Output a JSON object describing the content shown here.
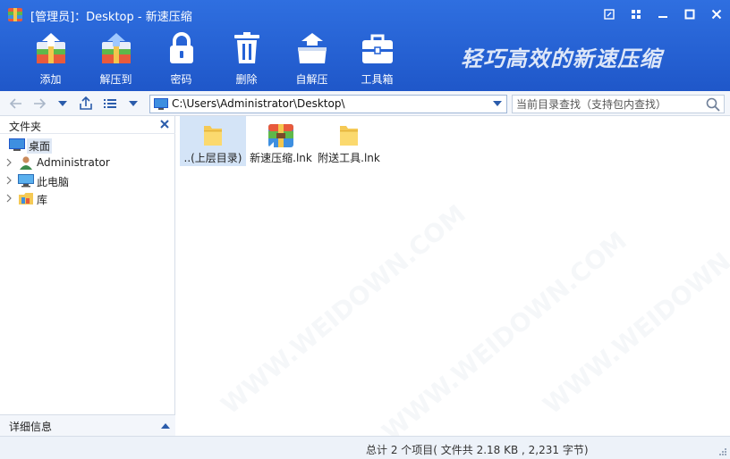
{
  "window": {
    "title": "[管理员]：Desktop - 新速压缩",
    "controls": [
      "skin-icon",
      "grid-icon",
      "minimize-icon",
      "maximize-icon",
      "close-icon"
    ]
  },
  "toolbar": {
    "items": [
      {
        "label": "添加",
        "icon": "add-archive-icon"
      },
      {
        "label": "解压到",
        "icon": "extract-to-icon"
      },
      {
        "label": "密码",
        "icon": "lock-icon"
      },
      {
        "label": "删除",
        "icon": "trash-icon"
      },
      {
        "label": "自解压",
        "icon": "self-extract-icon"
      },
      {
        "label": "工具箱",
        "icon": "toolbox-icon"
      }
    ],
    "slogan": "轻巧高效的新速压缩"
  },
  "address": {
    "path": "C:\\Users\\Administrator\\Desktop\\",
    "search_placeholder": "当前目录查找（支持包内查找）"
  },
  "left_panel": {
    "title": "文件夹",
    "tree": [
      {
        "label": "桌面",
        "icon": "desktop-icon",
        "selected": true,
        "expandable": false
      },
      {
        "label": "Administrator",
        "icon": "user-icon",
        "selected": false,
        "expandable": true
      },
      {
        "label": "此电脑",
        "icon": "computer-icon",
        "selected": false,
        "expandable": true
      },
      {
        "label": "库",
        "icon": "library-icon",
        "selected": false,
        "expandable": true
      }
    ],
    "footer_title": "详细信息"
  },
  "files": [
    {
      "label": "..(上层目录)",
      "icon": "folder-icon",
      "selected": true
    },
    {
      "label": "新速压缩.lnk",
      "icon": "archive-app-icon",
      "selected": false
    },
    {
      "label": "附送工具.lnk",
      "icon": "folder-icon",
      "selected": false
    }
  ],
  "status": {
    "text": "总计 2 个项目( 文件共 2.18 KB , 2,231 字节)"
  },
  "watermark": "WWW.WEIDOWN.COM",
  "colors": {
    "header": "#2462d6",
    "selection": "#d4e4f7",
    "folder": "#f5c955"
  }
}
